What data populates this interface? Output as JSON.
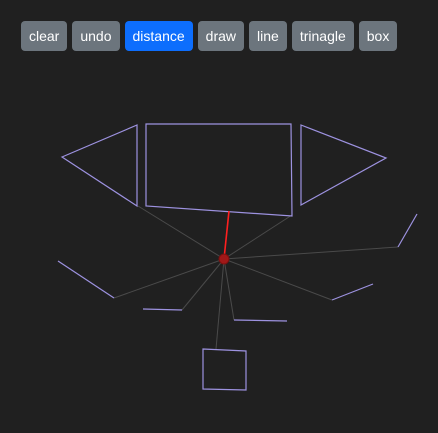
{
  "toolbar": {
    "buttons": [
      {
        "id": "clear",
        "label": "clear"
      },
      {
        "id": "undo",
        "label": "undo"
      },
      {
        "id": "distance",
        "label": "distance"
      },
      {
        "id": "draw",
        "label": "draw"
      },
      {
        "id": "line",
        "label": "line"
      },
      {
        "id": "tringle",
        "label": "trinagle"
      },
      {
        "id": "box",
        "label": "box"
      }
    ],
    "active": "distance"
  },
  "colors": {
    "background": "#202020",
    "button": "#6c757d",
    "button_active": "#0d6efd",
    "shape_stroke": "#9d92e0",
    "guide_line": "#4a4a4a",
    "nearest_line": "#ff1f1f",
    "origin_point": "#a01818"
  }
}
